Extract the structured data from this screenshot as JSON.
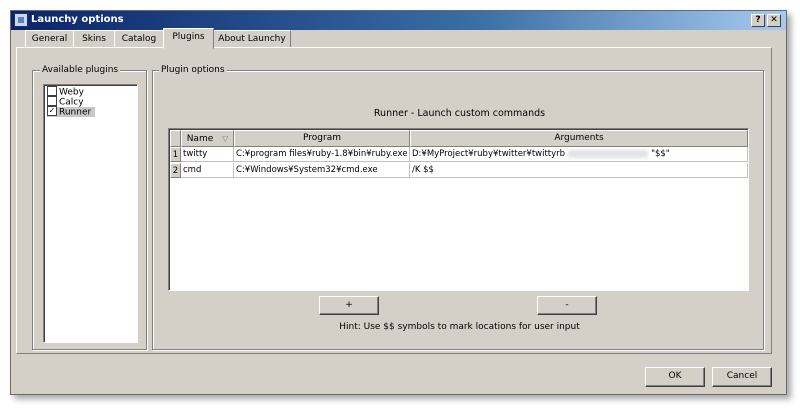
{
  "window": {
    "title": "Launchy options",
    "help_label": "?",
    "close_label": "✕"
  },
  "tabs": [
    {
      "label": "General"
    },
    {
      "label": "Skins"
    },
    {
      "label": "Catalog"
    },
    {
      "label": "Plugins",
      "active": true
    },
    {
      "label": "About Launchy"
    }
  ],
  "available_plugins": {
    "legend": "Available plugins",
    "items": [
      {
        "label": "Weby",
        "checked": false,
        "mark": ""
      },
      {
        "label": "Calcy",
        "checked": false,
        "mark": ""
      },
      {
        "label": "Runner",
        "checked": true,
        "mark": "✓"
      }
    ]
  },
  "plugin_options": {
    "legend": "Plugin options",
    "heading": "Runner - Launch custom commands",
    "columns": {
      "name": "Name",
      "program": "Program",
      "arguments": "Arguments"
    },
    "rows": [
      {
        "num": "1",
        "name": "twitty",
        "program": "C:¥program files¥ruby-1.8¥bin¥ruby.exe",
        "arguments_prefix": "D:¥MyProject¥ruby¥twitter¥twittyrb",
        "arguments_suffix": "\"$$\""
      },
      {
        "num": "2",
        "name": "cmd",
        "program": "C:¥Windows¥System32¥cmd.exe",
        "arguments_prefix": "/K $$",
        "arguments_suffix": ""
      }
    ],
    "add_label": "+",
    "remove_label": "-",
    "hint": "Hint: Use $$ symbols to mark locations for user input"
  },
  "footer": {
    "ok_label": "OK",
    "cancel_label": "Cancel"
  },
  "colors": {
    "title_gradient_start": "#0a246a",
    "title_gradient_end": "#a6caf0",
    "face": "#d4d0c8"
  }
}
